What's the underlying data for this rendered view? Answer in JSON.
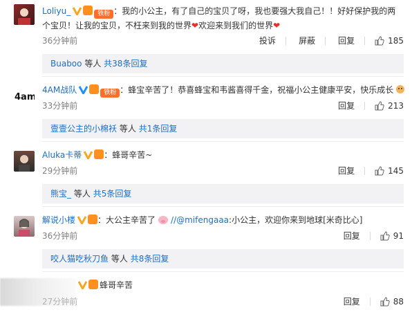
{
  "comments": [
    {
      "user": "Loliyu_",
      "fan_badge": "铁粉",
      "text_a": "：我的小公主，有了自己的宝贝了呀，我也要强大我自己！！好好保护我的两个宝贝！让我的宝贝，不枉来到我的世界",
      "text_b": "欢迎来到我们的世界",
      "time": "36分钟前",
      "actions": [
        "投诉",
        "屏蔽",
        "回复"
      ],
      "likes": "185",
      "replies": {
        "who": "Buaboo",
        "etc": "等人",
        "count": "共38条回复"
      }
    },
    {
      "user": "4AM战队",
      "fan_badge": "铁粉",
      "text_a": "：蜂宝辛苦了！恭喜蜂宝和韦酱喜得千金，祝福小公主健康平安，快乐成长",
      "time": "33分钟前",
      "actions": [
        "回复"
      ],
      "likes": "213",
      "replies": {
        "who": "壹壹公主的小棉袄",
        "etc": "等人",
        "count": "共1条回复"
      }
    },
    {
      "user": "Aluka卡蒂",
      "text_a": "：蜂哥辛苦~",
      "time": "29分钟前",
      "actions": [
        "回复"
      ],
      "likes": "145",
      "replies": {
        "who": "熊宝_",
        "etc": "等人",
        "count": "共5条回复"
      }
    },
    {
      "user": "解说小楼",
      "text_a": "：大公主辛苦了",
      "mention": "//@mifengaaa",
      "text_b": ":小公主，欢迎你来到地球[米奇比心]",
      "time": "36分钟前",
      "actions": [
        "回复"
      ],
      "likes": "91",
      "replies": {
        "who": "咬人猫吃秋刀鱼",
        "etc": "等人",
        "count": "共8条回复"
      }
    },
    {
      "user": "",
      "text_a": "蜂哥辛苦",
      "time": "27分钟前",
      "actions": [
        "回复"
      ],
      "likes": "88"
    }
  ],
  "colors": {
    "username": "#eb7350",
    "link": "#1a6ec6",
    "heart": "#e6302a",
    "fan_badge": "#ff6f29"
  }
}
